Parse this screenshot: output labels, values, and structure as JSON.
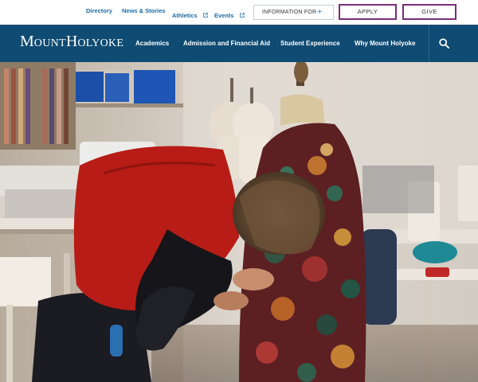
{
  "utility": {
    "links": [
      "Directory",
      "News & Stories",
      "Athletics",
      "Events"
    ],
    "info_label": "INFORMATION FOR",
    "info_plus": "+",
    "apply_label": "APPLY",
    "give_label": "GIVE"
  },
  "logo": {
    "first": "M",
    "mid": "OUNT",
    "second": "H",
    "rest": "OLYOKE"
  },
  "nav": {
    "items": [
      "Academics",
      "Admission and Financial Aid",
      "Student Experience",
      "Why Mount Holyoke"
    ]
  },
  "colors": {
    "nav_bg": "#0f4b72",
    "link": "#1a6aa8",
    "cta_border": "#7b2d7b"
  }
}
